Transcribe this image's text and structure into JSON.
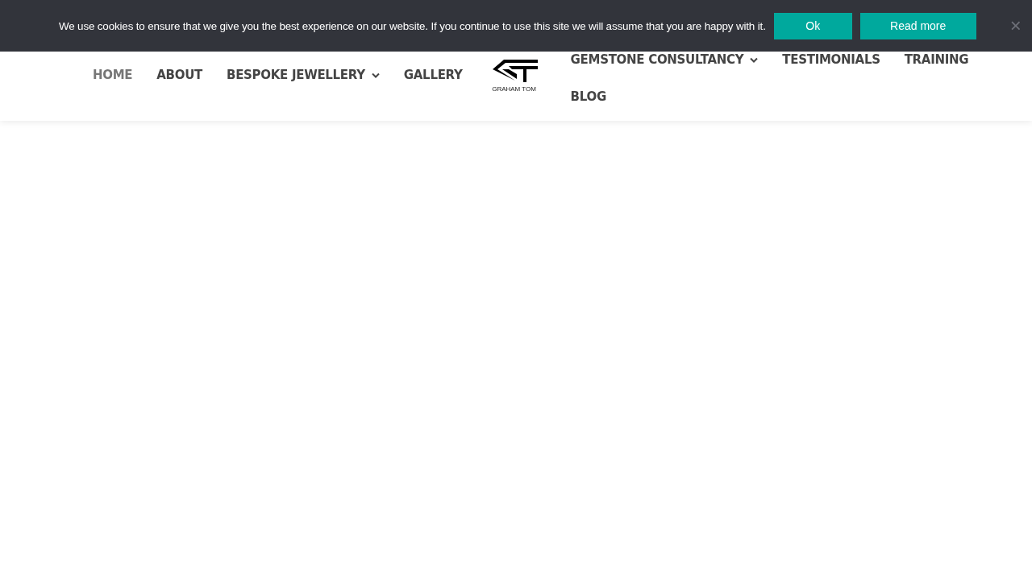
{
  "cookie_bar": {
    "message": "We use cookies to ensure that we give you the best experience on our website. If you continue to use this site we will assume that you are happy with it.",
    "buttons": [
      "Ok",
      "Read more"
    ],
    "close": "×"
  },
  "nav_left": [
    {
      "label": "HOME",
      "selected": true,
      "dropdown": false
    },
    {
      "label": "ABOUT",
      "selected": false,
      "dropdown": false
    },
    {
      "label": "BESPOKE JEWELLERY",
      "selected": false,
      "dropdown": true
    },
    {
      "label": "GALLERY",
      "selected": false,
      "dropdown": false
    }
  ],
  "logo": {
    "text": "GRAHAM TOM"
  },
  "nav_right": [
    {
      "label": "GEMSTONE CONSULTANCY",
      "selected": false,
      "dropdown": true
    },
    {
      "label": "TESTIMONIALS",
      "selected": false,
      "dropdown": false
    },
    {
      "label": "TRAINING",
      "selected": false,
      "dropdown": false
    },
    {
      "label": "BLOG",
      "selected": false,
      "dropdown": false
    }
  ]
}
